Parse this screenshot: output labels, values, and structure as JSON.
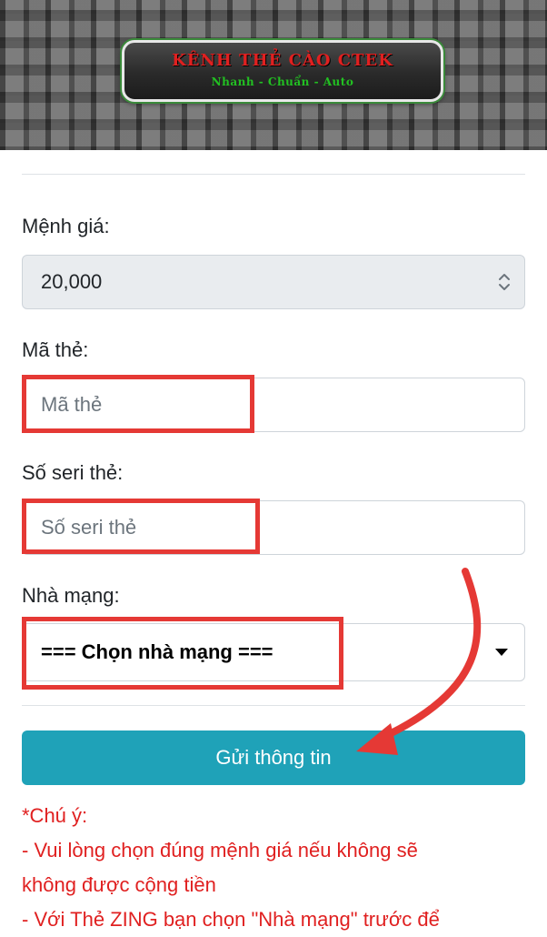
{
  "header": {
    "title": "KÊNH THẺ CÀO CTEK",
    "subtitle": "Nhanh - Chuẩn - Auto"
  },
  "form": {
    "denomination": {
      "label": "Mệnh giá:",
      "value": "20,000"
    },
    "card_code": {
      "label": "Mã thẻ:",
      "placeholder": "Mã thẻ"
    },
    "serial": {
      "label": "Số seri thẻ:",
      "placeholder": "Số seri thẻ"
    },
    "carrier": {
      "label": "Nhà mạng:",
      "value": "=== Chọn nhà mạng ==="
    },
    "submit_label": "Gửi thông tin"
  },
  "notes": {
    "title": "*Chú ý:",
    "lines": [
      "- Vui lòng chọn đúng mệnh giá nếu không sẽ",
      "không được cộng tiền",
      "- Với Thẻ ZING bạn chọn \"Nhà mạng\" trước để"
    ]
  },
  "colors": {
    "accent": "#1fa2b8",
    "highlight": "#e53935",
    "warning_text": "#e02020"
  }
}
